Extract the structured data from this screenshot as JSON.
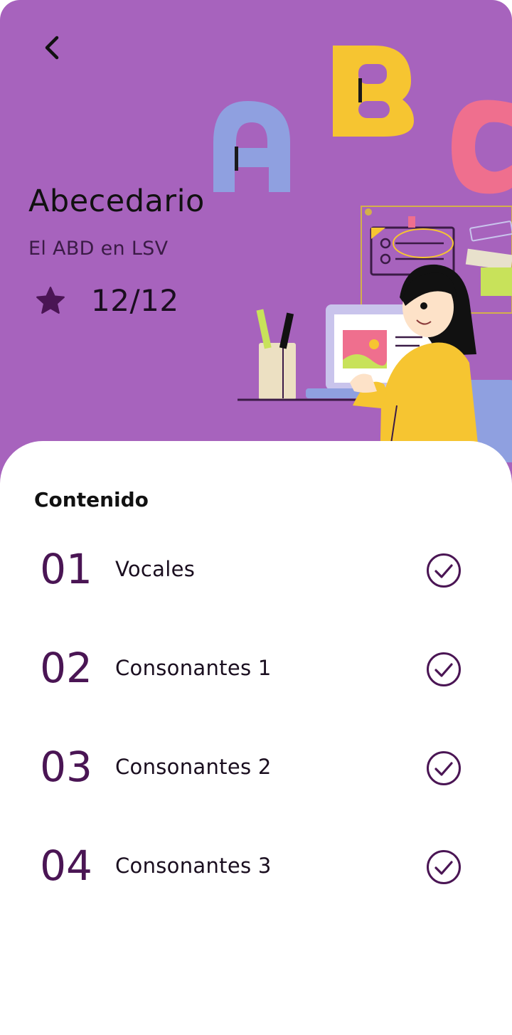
{
  "header": {
    "back_icon": "chevron-left-icon",
    "title": "Abecedario",
    "subtitle": "El ABD en LSV",
    "score": {
      "icon": "star-icon",
      "value": "12/12"
    }
  },
  "content": {
    "section_title": "Contenido",
    "lessons": [
      {
        "number": "01",
        "label": "Vocales",
        "completed": true,
        "status_icon": "check-circle-icon"
      },
      {
        "number": "02",
        "label": "Consonantes 1",
        "completed": true,
        "status_icon": "check-circle-icon"
      },
      {
        "number": "03",
        "label": "Consonantes 2",
        "completed": true,
        "status_icon": "check-circle-icon"
      },
      {
        "number": "04",
        "label": "Consonantes 3",
        "completed": true,
        "status_icon": "check-circle-icon"
      }
    ]
  },
  "colors": {
    "hero_background": "#a763bd",
    "accent_dark_purple": "#4a1554",
    "letter_a": "#8fa0e0",
    "letter_b": "#f6c531",
    "letter_c": "#ef6f8e",
    "card_background": "#ffffff"
  }
}
